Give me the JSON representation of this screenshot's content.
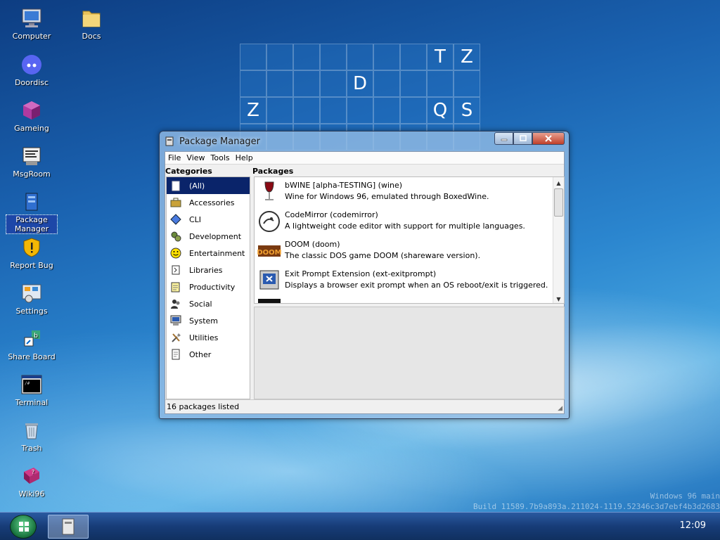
{
  "desktop": {
    "icons": [
      {
        "label": "Computer"
      },
      {
        "label": "Docs"
      },
      {
        "label": "Doordisc"
      },
      {
        "label": "Gameing"
      },
      {
        "label": "MsgRoom"
      },
      {
        "label": "Package Manager"
      },
      {
        "label": "Report Bug"
      },
      {
        "label": "Settings"
      },
      {
        "label": "Share Board"
      },
      {
        "label": "Terminal"
      },
      {
        "label": "Trash"
      },
      {
        "label": "Wiki96"
      }
    ],
    "tiles": [
      "",
      "",
      "",
      "",
      "",
      "",
      "",
      "T",
      "Z",
      "",
      "",
      "",
      "",
      "D",
      "",
      "",
      "",
      "",
      "Z",
      "",
      "",
      "",
      "",
      "",
      "",
      "Q",
      "S",
      "",
      "",
      "",
      "",
      "",
      "",
      "",
      "",
      ""
    ]
  },
  "window": {
    "title": "Package Manager",
    "menu": [
      "File",
      "View",
      "Tools",
      "Help"
    ],
    "categories_header": "Categories",
    "packages_header": "Packages",
    "categories": [
      {
        "label": "(All)",
        "icon": "all-icon",
        "selected": true
      },
      {
        "label": "Accessories",
        "icon": "briefcase-icon"
      },
      {
        "label": "CLI",
        "icon": "diamond-icon"
      },
      {
        "label": "Development",
        "icon": "gears-icon"
      },
      {
        "label": "Entertainment",
        "icon": "smiley-icon"
      },
      {
        "label": "Libraries",
        "icon": "book-icon"
      },
      {
        "label": "Productivity",
        "icon": "notepad-icon"
      },
      {
        "label": "Social",
        "icon": "people-icon"
      },
      {
        "label": "System",
        "icon": "computer-icon"
      },
      {
        "label": "Utilities",
        "icon": "tools-icon"
      },
      {
        "label": "Other",
        "icon": "document-icon"
      }
    ],
    "packages": [
      {
        "name": "bWINE [alpha-TESTING] (wine)",
        "description": "Wine for Windows 96, emulated through BoxedWine.",
        "icon": "wine-glass-icon"
      },
      {
        "name": "CodeMirror (codemirror)",
        "description": "A lightweight code editor with support for multiple languages.",
        "icon": "codemirror-icon"
      },
      {
        "name": "DOOM (doom)",
        "description": "The classic DOS game DOOM (shareware version).",
        "icon": "doom-icon"
      },
      {
        "name": "Exit Prompt Extension (ext-exitprompt)",
        "description": "Displays a browser exit prompt when an OS reboot/exit is triggered.",
        "icon": "exit-prompt-icon"
      }
    ],
    "status": "16 packages listed"
  },
  "taskbar": {
    "clock": "12:09"
  },
  "build_info": {
    "line1": "Windows 96 main",
    "line2": "Build 11589.7b9a893a.211024-1119.52346c3d7ebf4b3d2683"
  },
  "colors": {
    "selection": "#0a246a",
    "close_button": "#c0402a"
  }
}
